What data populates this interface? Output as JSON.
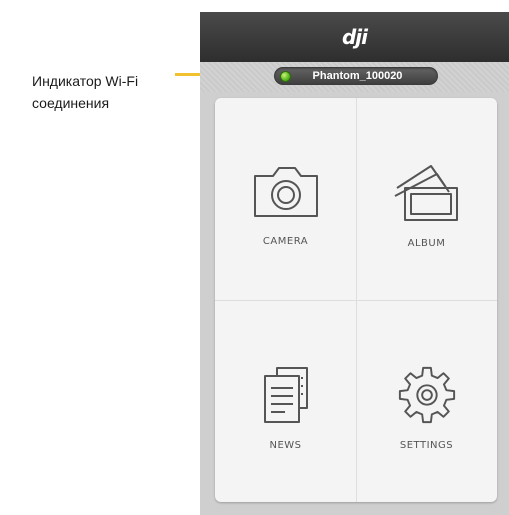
{
  "annotation": {
    "line1": "Индикатор Wi-Fi",
    "line2": "соединения",
    "color": "#f2c12e"
  },
  "app": {
    "logo_text": "dji",
    "wifi": {
      "network_name": "Phantom_100020",
      "status_color": "#58b81b",
      "icon": "wifi-status-dot"
    }
  },
  "menu": {
    "tiles": [
      {
        "label": "CAMERA",
        "icon": "camera-icon"
      },
      {
        "label": "ALBUM",
        "icon": "album-icon"
      },
      {
        "label": "NEWS",
        "icon": "news-icon"
      },
      {
        "label": "SETTINGS",
        "icon": "gear-icon"
      }
    ]
  }
}
